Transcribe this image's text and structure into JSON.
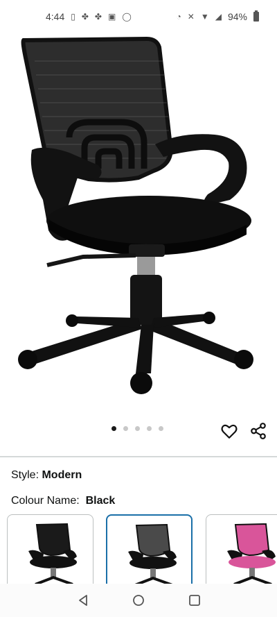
{
  "status_bar": {
    "time": "4:44",
    "battery": "94%",
    "left_icons": [
      "sim-icon",
      "pinwheel-icon",
      "pinwheel-icon",
      "image-icon",
      "whatsapp-icon"
    ],
    "right_icons": [
      "data-saver-icon",
      "mute-icon",
      "wifi-icon",
      "signal-icon",
      "battery-icon"
    ]
  },
  "product_image": {
    "alt": "Black mesh office chair",
    "carousel_total": 5,
    "carousel_active_index": 0
  },
  "actions": {
    "wishlist_icon": "heart-icon",
    "share_icon": "share-icon"
  },
  "variations": {
    "style_label": "Style:",
    "style_value": "Modern",
    "colour_label": "Colour Name:",
    "colour_value": "Black",
    "swatches": [
      {
        "name": "black",
        "color": "#1a1a1a",
        "selected": false
      },
      {
        "name": "grey",
        "color": "#4a4a4a",
        "selected": true
      },
      {
        "name": "pink",
        "color": "#d9559a",
        "selected": false
      }
    ]
  },
  "colors": {
    "selected_border": "#1a6fa8",
    "divider": "#d5d9d9"
  }
}
